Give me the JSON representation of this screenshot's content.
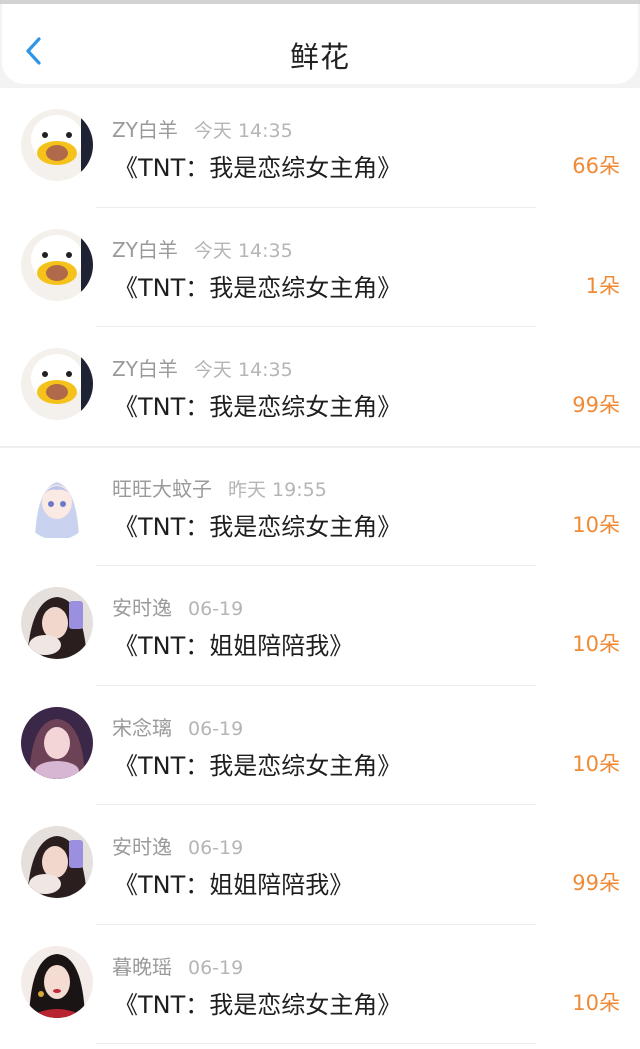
{
  "header": {
    "title": "鲜花",
    "back_icon": "chevron-left-icon",
    "accent": "#2f95e8"
  },
  "colors": {
    "count": "#f08a35",
    "meta": "#9a9a9a"
  },
  "items": [
    {
      "name": "ZY白羊",
      "time": "今天 14:35",
      "song": "《TNT：我是恋综女主角》",
      "count": "66朵",
      "avatar": "duck"
    },
    {
      "name": "ZY白羊",
      "time": "今天 14:35",
      "song": "《TNT：我是恋综女主角》",
      "count": "1朵",
      "avatar": "duck"
    },
    {
      "name": "ZY白羊",
      "time": "今天 14:35",
      "song": "《TNT：我是恋综女主角》",
      "count": "99朵",
      "avatar": "duck"
    },
    {
      "name": "旺旺大蚊子",
      "time": "昨天 19:55",
      "song": "《TNT：我是恋综女主角》",
      "count": "10朵",
      "avatar": "anime"
    },
    {
      "name": "安时逸",
      "time": "06-19",
      "song": "《TNT：姐姐陪陪我》",
      "count": "10朵",
      "avatar": "girl-phone"
    },
    {
      "name": "宋念璃",
      "time": "06-19",
      "song": "《TNT：我是恋综女主角》",
      "count": "10朵",
      "avatar": "girl-purple"
    },
    {
      "name": "安时逸",
      "time": "06-19",
      "song": "《TNT：姐姐陪陪我》",
      "count": "99朵",
      "avatar": "girl-phone"
    },
    {
      "name": "暮晚瑶",
      "time": "06-19",
      "song": "《TNT：我是恋综女主角》",
      "count": "10朵",
      "avatar": "girl-red"
    }
  ]
}
